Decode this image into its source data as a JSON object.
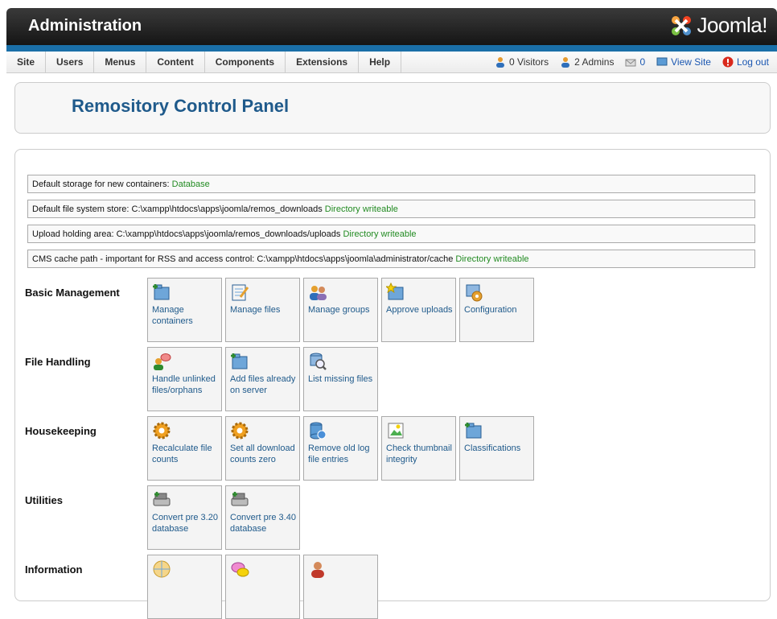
{
  "header": {
    "title": "Administration",
    "logo_text": "Joomla!"
  },
  "menu": [
    "Site",
    "Users",
    "Menus",
    "Content",
    "Components",
    "Extensions",
    "Help"
  ],
  "status": {
    "visitors": "0 Visitors",
    "admins": "2 Admins",
    "messages": "0",
    "view_site": "View Site",
    "logout": "Log out"
  },
  "page_title": "Remository Control Panel",
  "info": [
    {
      "label": "Default storage for new containers: ",
      "value": "",
      "ok": "Database"
    },
    {
      "label": "Default file system store: ",
      "value": "C:\\xampp\\htdocs\\apps\\joomla/remos_downloads ",
      "ok": "Directory writeable"
    },
    {
      "label": "Upload holding area: ",
      "value": "C:\\xampp\\htdocs\\apps\\joomla/remos_downloads/uploads ",
      "ok": "Directory writeable"
    },
    {
      "label": "CMS cache path - important for RSS and access control: ",
      "value": "C:\\xampp\\htdocs\\apps\\joomla\\administrator/cache ",
      "ok": "Directory writeable"
    }
  ],
  "sections": [
    {
      "title": "Basic Management",
      "items": [
        {
          "label": "Manage containers",
          "icon": "folder-add-icon"
        },
        {
          "label": "Manage files",
          "icon": "edit-file-icon"
        },
        {
          "label": "Manage groups",
          "icon": "users-icon"
        },
        {
          "label": "Approve uploads",
          "icon": "star-folder-icon"
        },
        {
          "label": "Configuration",
          "icon": "config-icon"
        }
      ]
    },
    {
      "title": "File Handling",
      "items": [
        {
          "label": "Handle unlinked files/orphans",
          "icon": "user-chat-icon"
        },
        {
          "label": "Add files already on server",
          "icon": "folder-add-icon"
        },
        {
          "label": "List missing files",
          "icon": "search-db-icon"
        }
      ]
    },
    {
      "title": "Housekeeping",
      "items": [
        {
          "label": "Recalculate file counts",
          "icon": "gear-icon"
        },
        {
          "label": "Set all download counts zero",
          "icon": "gear-icon"
        },
        {
          "label": "Remove old log file entries",
          "icon": "database-icon"
        },
        {
          "label": "Check thumbnail integrity",
          "icon": "picture-icon"
        },
        {
          "label": "Classifications",
          "icon": "folder-add-icon"
        }
      ]
    },
    {
      "title": "Utilities",
      "items": [
        {
          "label": "Convert pre 3.20 database",
          "icon": "drive-icon"
        },
        {
          "label": "Convert pre 3.40 database",
          "icon": "drive-icon"
        }
      ]
    },
    {
      "title": "Information",
      "items": [
        {
          "label": "",
          "icon": "globe-icon"
        },
        {
          "label": "",
          "icon": "chat-icon"
        },
        {
          "label": "",
          "icon": "person-icon"
        }
      ]
    }
  ]
}
